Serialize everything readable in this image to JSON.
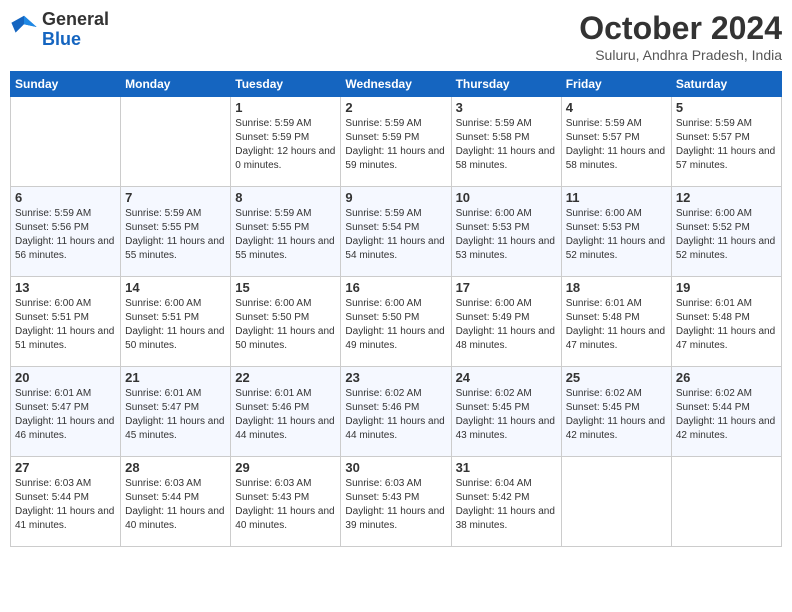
{
  "logo": {
    "general": "General",
    "blue": "Blue"
  },
  "header": {
    "month": "October 2024",
    "location": "Suluru, Andhra Pradesh, India"
  },
  "weekdays": [
    "Sunday",
    "Monday",
    "Tuesday",
    "Wednesday",
    "Thursday",
    "Friday",
    "Saturday"
  ],
  "weeks": [
    [
      {
        "day": "",
        "info": ""
      },
      {
        "day": "",
        "info": ""
      },
      {
        "day": "1",
        "info": "Sunrise: 5:59 AM\nSunset: 5:59 PM\nDaylight: 12 hours\nand 0 minutes."
      },
      {
        "day": "2",
        "info": "Sunrise: 5:59 AM\nSunset: 5:59 PM\nDaylight: 11 hours\nand 59 minutes."
      },
      {
        "day": "3",
        "info": "Sunrise: 5:59 AM\nSunset: 5:58 PM\nDaylight: 11 hours\nand 58 minutes."
      },
      {
        "day": "4",
        "info": "Sunrise: 5:59 AM\nSunset: 5:57 PM\nDaylight: 11 hours\nand 58 minutes."
      },
      {
        "day": "5",
        "info": "Sunrise: 5:59 AM\nSunset: 5:57 PM\nDaylight: 11 hours\nand 57 minutes."
      }
    ],
    [
      {
        "day": "6",
        "info": "Sunrise: 5:59 AM\nSunset: 5:56 PM\nDaylight: 11 hours\nand 56 minutes."
      },
      {
        "day": "7",
        "info": "Sunrise: 5:59 AM\nSunset: 5:55 PM\nDaylight: 11 hours\nand 55 minutes."
      },
      {
        "day": "8",
        "info": "Sunrise: 5:59 AM\nSunset: 5:55 PM\nDaylight: 11 hours\nand 55 minutes."
      },
      {
        "day": "9",
        "info": "Sunrise: 5:59 AM\nSunset: 5:54 PM\nDaylight: 11 hours\nand 54 minutes."
      },
      {
        "day": "10",
        "info": "Sunrise: 6:00 AM\nSunset: 5:53 PM\nDaylight: 11 hours\nand 53 minutes."
      },
      {
        "day": "11",
        "info": "Sunrise: 6:00 AM\nSunset: 5:53 PM\nDaylight: 11 hours\nand 52 minutes."
      },
      {
        "day": "12",
        "info": "Sunrise: 6:00 AM\nSunset: 5:52 PM\nDaylight: 11 hours\nand 52 minutes."
      }
    ],
    [
      {
        "day": "13",
        "info": "Sunrise: 6:00 AM\nSunset: 5:51 PM\nDaylight: 11 hours\nand 51 minutes."
      },
      {
        "day": "14",
        "info": "Sunrise: 6:00 AM\nSunset: 5:51 PM\nDaylight: 11 hours\nand 50 minutes."
      },
      {
        "day": "15",
        "info": "Sunrise: 6:00 AM\nSunset: 5:50 PM\nDaylight: 11 hours\nand 50 minutes."
      },
      {
        "day": "16",
        "info": "Sunrise: 6:00 AM\nSunset: 5:50 PM\nDaylight: 11 hours\nand 49 minutes."
      },
      {
        "day": "17",
        "info": "Sunrise: 6:00 AM\nSunset: 5:49 PM\nDaylight: 11 hours\nand 48 minutes."
      },
      {
        "day": "18",
        "info": "Sunrise: 6:01 AM\nSunset: 5:48 PM\nDaylight: 11 hours\nand 47 minutes."
      },
      {
        "day": "19",
        "info": "Sunrise: 6:01 AM\nSunset: 5:48 PM\nDaylight: 11 hours\nand 47 minutes."
      }
    ],
    [
      {
        "day": "20",
        "info": "Sunrise: 6:01 AM\nSunset: 5:47 PM\nDaylight: 11 hours\nand 46 minutes."
      },
      {
        "day": "21",
        "info": "Sunrise: 6:01 AM\nSunset: 5:47 PM\nDaylight: 11 hours\nand 45 minutes."
      },
      {
        "day": "22",
        "info": "Sunrise: 6:01 AM\nSunset: 5:46 PM\nDaylight: 11 hours\nand 44 minutes."
      },
      {
        "day": "23",
        "info": "Sunrise: 6:02 AM\nSunset: 5:46 PM\nDaylight: 11 hours\nand 44 minutes."
      },
      {
        "day": "24",
        "info": "Sunrise: 6:02 AM\nSunset: 5:45 PM\nDaylight: 11 hours\nand 43 minutes."
      },
      {
        "day": "25",
        "info": "Sunrise: 6:02 AM\nSunset: 5:45 PM\nDaylight: 11 hours\nand 42 minutes."
      },
      {
        "day": "26",
        "info": "Sunrise: 6:02 AM\nSunset: 5:44 PM\nDaylight: 11 hours\nand 42 minutes."
      }
    ],
    [
      {
        "day": "27",
        "info": "Sunrise: 6:03 AM\nSunset: 5:44 PM\nDaylight: 11 hours\nand 41 minutes."
      },
      {
        "day": "28",
        "info": "Sunrise: 6:03 AM\nSunset: 5:44 PM\nDaylight: 11 hours\nand 40 minutes."
      },
      {
        "day": "29",
        "info": "Sunrise: 6:03 AM\nSunset: 5:43 PM\nDaylight: 11 hours\nand 40 minutes."
      },
      {
        "day": "30",
        "info": "Sunrise: 6:03 AM\nSunset: 5:43 PM\nDaylight: 11 hours\nand 39 minutes."
      },
      {
        "day": "31",
        "info": "Sunrise: 6:04 AM\nSunset: 5:42 PM\nDaylight: 11 hours\nand 38 minutes."
      },
      {
        "day": "",
        "info": ""
      },
      {
        "day": "",
        "info": ""
      }
    ]
  ]
}
